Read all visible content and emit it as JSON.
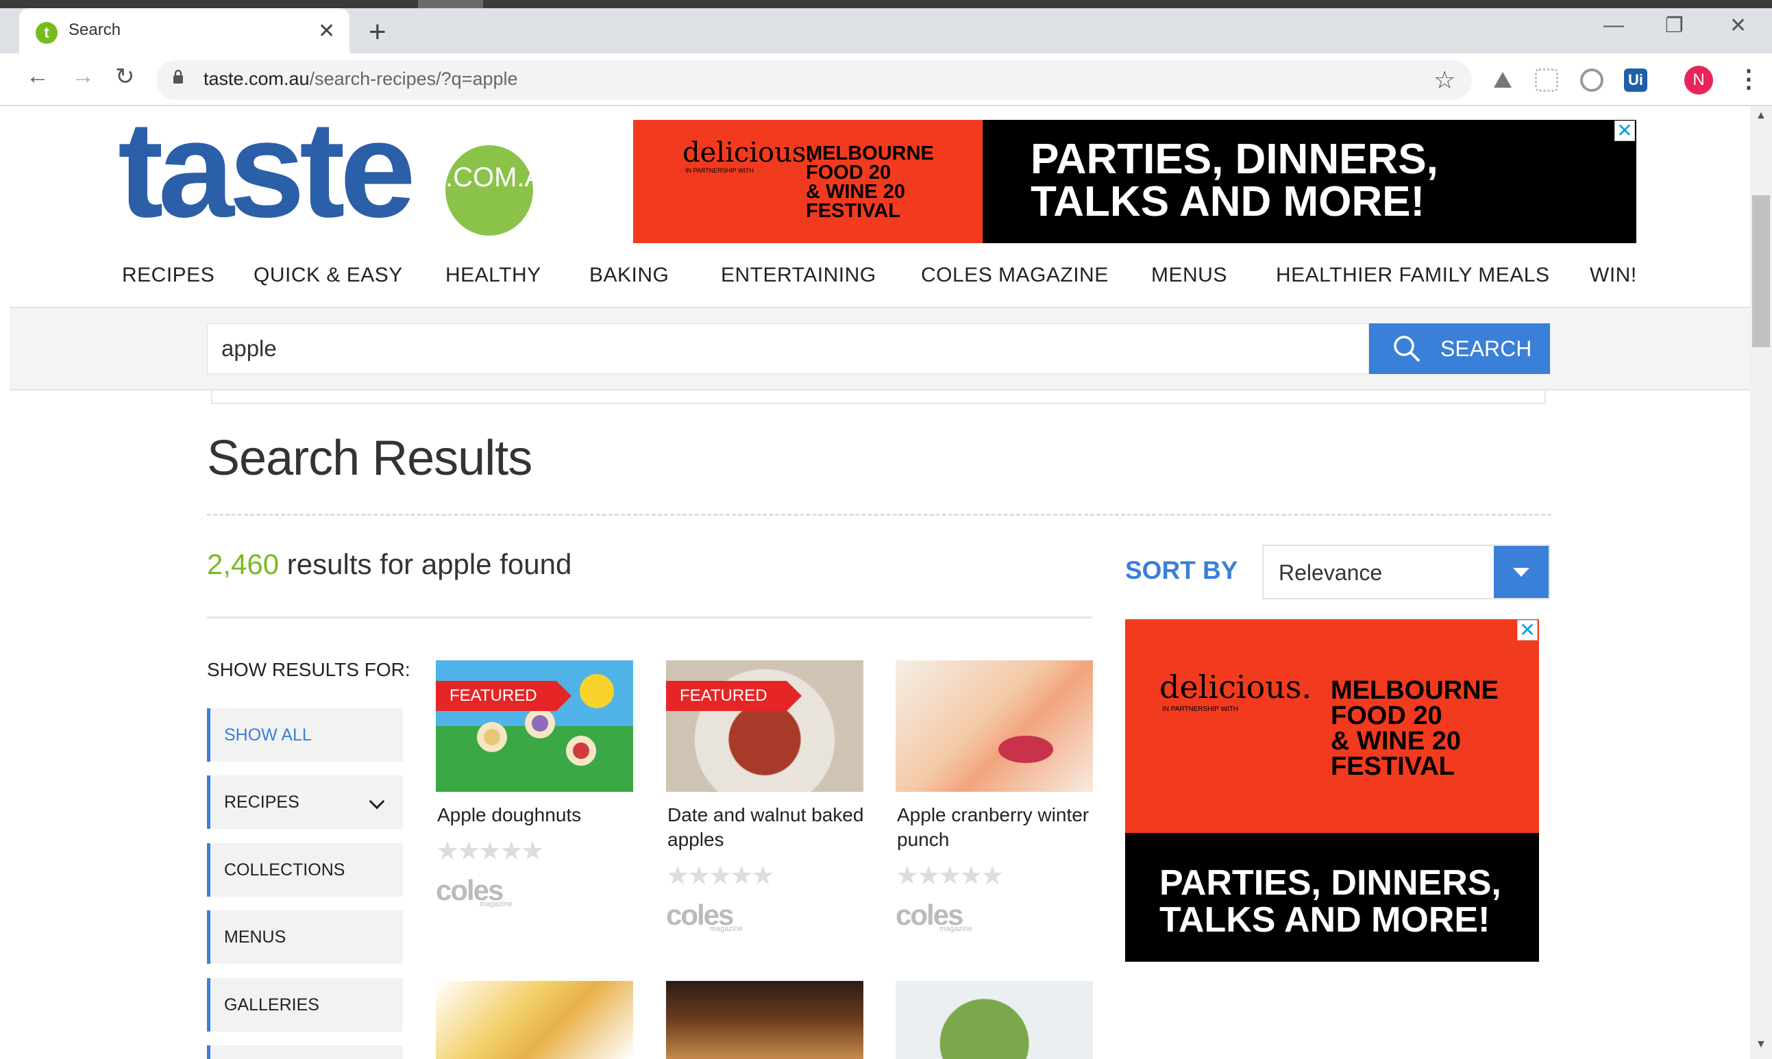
{
  "browser": {
    "tab_title": "Search",
    "tab_favicon_letter": "t",
    "url_domain": "taste.com.au",
    "url_path": "/search-recipes/?q=apple",
    "profile_initial": "N",
    "extensions": [
      "drive-icon",
      "extension-icon",
      "camera-icon",
      "uipath-icon"
    ],
    "uipath_label": "Ui"
  },
  "site": {
    "logo_text": "taste",
    "logo_badge": ".COM.AU",
    "nav": [
      "RECIPES",
      "QUICK & EASY",
      "HEALTHY",
      "BAKING",
      "ENTERTAINING",
      "COLES MAGAZINE",
      "MENUS",
      "HEALTHIER FAMILY MEALS",
      "WIN!"
    ]
  },
  "ad_top": {
    "brand": "delicious.",
    "partner": "IN PARTNERSHIP WITH",
    "festival_lines": [
      "MELBOURNE",
      "FOOD 20",
      "& WINE 20",
      "FESTIVAL"
    ],
    "headline_lines": [
      "PARTIES, DINNERS,",
      "TALKS AND MORE!"
    ]
  },
  "search": {
    "value": "apple",
    "button_label": "SEARCH"
  },
  "results": {
    "title": "Search Results",
    "count": "2,460",
    "count_suffix": " results for apple found",
    "sort_label": "SORT BY",
    "sort_value": "Relevance",
    "show_for_label": "SHOW RESULTS FOR:",
    "filters": [
      "SHOW ALL",
      "RECIPES",
      "COLLECTIONS",
      "MENUS",
      "GALLERIES"
    ]
  },
  "cards": [
    {
      "title": "Apple doughnuts",
      "featured": "FEATURED",
      "rating": "★★★★★",
      "brand": "coles",
      "brand_sub": "magazine"
    },
    {
      "title": "Date and walnut baked apples",
      "featured": "FEATURED",
      "rating": "★★★★★",
      "brand": "coles",
      "brand_sub": "magazine"
    },
    {
      "title": "Apple cranberry winter punch",
      "featured": "",
      "rating": "★★★★★",
      "brand": "coles",
      "brand_sub": "magazine"
    }
  ],
  "ad_side": {
    "brand": "delicious.",
    "partner": "IN PARTNERSHIP WITH",
    "festival_lines": [
      "MELBOURNE",
      "FOOD 20",
      "& WINE 20",
      "FESTIVAL"
    ],
    "headline_lines": [
      "PARTIES, DINNERS,",
      "TALKS AND MORE!"
    ]
  },
  "colors": {
    "brand_blue": "#2b5fa8",
    "brand_green": "#77bc1f",
    "accent_blue": "#3a7fd8",
    "featured_red": "#e62626"
  }
}
